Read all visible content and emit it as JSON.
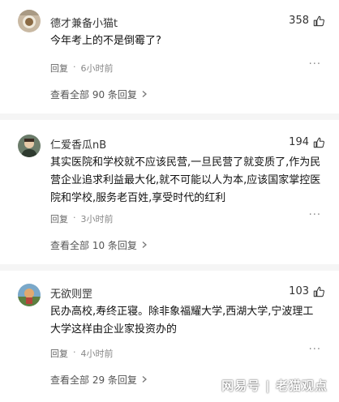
{
  "comments": [
    {
      "username": "德才兼备小猫t",
      "likes": "358",
      "text": "今年考上的不是倒霉了?",
      "reply_label": "回复",
      "time": "6小时前",
      "expand_label": "查看全部 90 条回复"
    },
    {
      "username": "仁爱香瓜nB",
      "likes": "194",
      "text": "其实医院和学校就不应该民营,一旦民营了就变质了,作为民营企业追求利益最大化,就不可能以人为本,应该国家掌控医院和学校,服务老百姓,享受时代的红利",
      "reply_label": "回复",
      "time": "3小时前",
      "expand_label": "查看全部 10 条回复"
    },
    {
      "username": "无欲则罡",
      "likes": "103",
      "text": "民办高校,寿终正寝。除非象福耀大学,西湖大学,宁波理工大学这样由企业家投资办的",
      "reply_label": "回复",
      "time": "4小时前",
      "expand_label": "查看全部 29 条回复"
    }
  ],
  "separator_dot": "·",
  "more_glyph": "···",
  "watermark": "网易号 | 老猫观点",
  "icons": {
    "like": "thumbs-up-icon",
    "expand": "chevron-right-icon",
    "more": "more-dots-icon"
  }
}
